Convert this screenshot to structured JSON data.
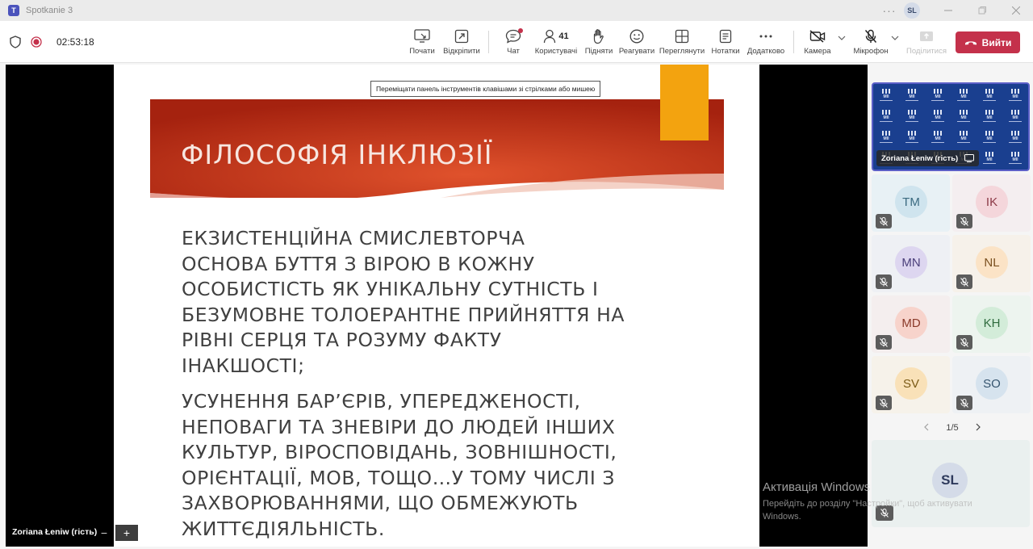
{
  "window": {
    "title": "Spotkanie 3",
    "user_initials": "SL",
    "more_label": "···"
  },
  "meeting": {
    "elapsed": "02:53:18"
  },
  "toolbar": {
    "start_label": "Почати",
    "popout_label": "Відкріпити",
    "chat_label": "Чат",
    "people_label": "Користувачі",
    "people_count": "41",
    "raise_label": "Підняти",
    "react_label": "Реагувати",
    "view_label": "Переглянути",
    "notes_label": "Нотатки",
    "more_label": "Додатково",
    "camera_label": "Камера",
    "mic_label": "Мікрофон",
    "share_label": "Поділитися",
    "leave_label": "Вийти"
  },
  "stage": {
    "tooltip": "Переміщати панель інструментів клавішами зі стрілками або мишею",
    "presenter_name": "Zoriana Łeniw (гість)",
    "zoom_minus": "−",
    "zoom_plus": "+"
  },
  "slide": {
    "title": "ФІЛОСОФІЯ ІНКЛЮЗІЇ",
    "para1_lines": [
      "ЕКЗИСТЕНЦІЙНА СМИСЛЕВТОРЧА",
      "ОСНОВА БУТТЯ З ВІРОЮ В КОЖНУ",
      "ОСОБИСТІСТЬ ЯК УНІКАЛЬНУ СУТНІСТЬ І",
      "БЕЗУМОВНЕ ТОЛОЕРАНТНЕ ПРИЙНЯТТЯ НА",
      "РІВНІ СЕРЦЯ ТА РОЗУМУ ФАКТУ",
      "ІНАКШОСТІ;"
    ],
    "para2_lines": [
      "УСУНЕННЯ БАР’ЄРІВ, УПЕРЕДЖЕНОСТІ,",
      "НЕПОВАГИ ТА ЗНЕВІРИ ДО ЛЮДЕЙ ІНШИХ",
      "КУЛЬТУР, ВІРОСПОВІДАНЬ, ЗОВНІШНОСТІ,",
      "ОРІЄНТАЦІЇ, МОВ, ТОЩО…У ТОМУ ЧИСЛІ З",
      "ЗАХВОРЮВАННЯМИ, ЩО ОБМЕЖУЮТЬ",
      "ЖИТТЄДІЯЛЬНІСТЬ."
    ]
  },
  "panel": {
    "presenter_tile_name": "Zoriana Łeniw (гість)",
    "presenter_bg_label": "МІІ",
    "participants": [
      {
        "initials": "TM",
        "bg": "#e8f1f5",
        "av": "#cfe4ee",
        "fg": "#3b6a80"
      },
      {
        "initials": "IK",
        "bg": "#f4eef0",
        "av": "#f4d6db",
        "fg": "#8c3a47"
      },
      {
        "initials": "MN",
        "bg": "#eef0f4",
        "av": "#ddd6f0",
        "fg": "#4b3f7a"
      },
      {
        "initials": "NL",
        "bg": "#f6f1ea",
        "av": "#fbe3c6",
        "fg": "#7a5020"
      },
      {
        "initials": "MD",
        "bg": "#f4eeee",
        "av": "#f7d3cb",
        "fg": "#8a3a2a"
      },
      {
        "initials": "KH",
        "bg": "#edf4ef",
        "av": "#d3ecd9",
        "fg": "#2f6b3e"
      },
      {
        "initials": "SV",
        "bg": "#f6f2ea",
        "av": "#f9e1b8",
        "fg": "#7a5a16"
      },
      {
        "initials": "SO",
        "bg": "#eef1f4",
        "av": "#d6e3ee",
        "fg": "#35546e"
      }
    ],
    "pager": "1/5",
    "self_initials": "SL"
  },
  "watermark": {
    "title": "Активація Windows",
    "line": "Перейдіть до розділу \"Настройки\", щоб активувати Windows."
  },
  "colors": {
    "leave": "#c4314b",
    "banner_dark": "#a5220f",
    "banner_light": "#e0522c",
    "accent_tab": "#f3a30f",
    "teams": "#5b5fc7"
  }
}
